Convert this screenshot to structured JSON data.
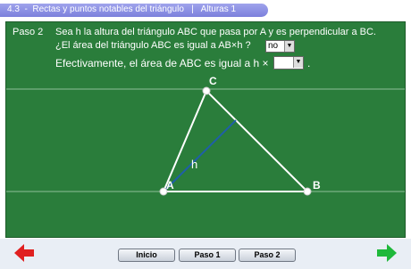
{
  "header": {
    "title": "4.3  -  Rectas y puntos notables del triángulo   |   Alturas 1"
  },
  "step": {
    "label": "Paso 2",
    "line1": "Sea h la altura del triángulo ABC que pasa por A y es perpendicular a BC.",
    "line2": "¿El área del triángulo ABC es igual a AB×h ?",
    "answer1": "no",
    "line3": "Efectivamente, el área de ABC es igual a  h ×",
    "answer2": "",
    "line3_end": "."
  },
  "figure": {
    "vertex_a": "A",
    "vertex_b": "B",
    "vertex_c": "C",
    "height_label": "h"
  },
  "nav": {
    "inicio": "Inicio",
    "paso1": "Paso 1",
    "paso2": "Paso 2"
  },
  "icons": {
    "back": "left-arrow-icon",
    "forward": "right-arrow-icon"
  },
  "colors": {
    "board": "#2a7d3b",
    "height_line": "#1f5fa8",
    "back_arrow": "#e02020",
    "forward_arrow": "#1fb83a"
  }
}
